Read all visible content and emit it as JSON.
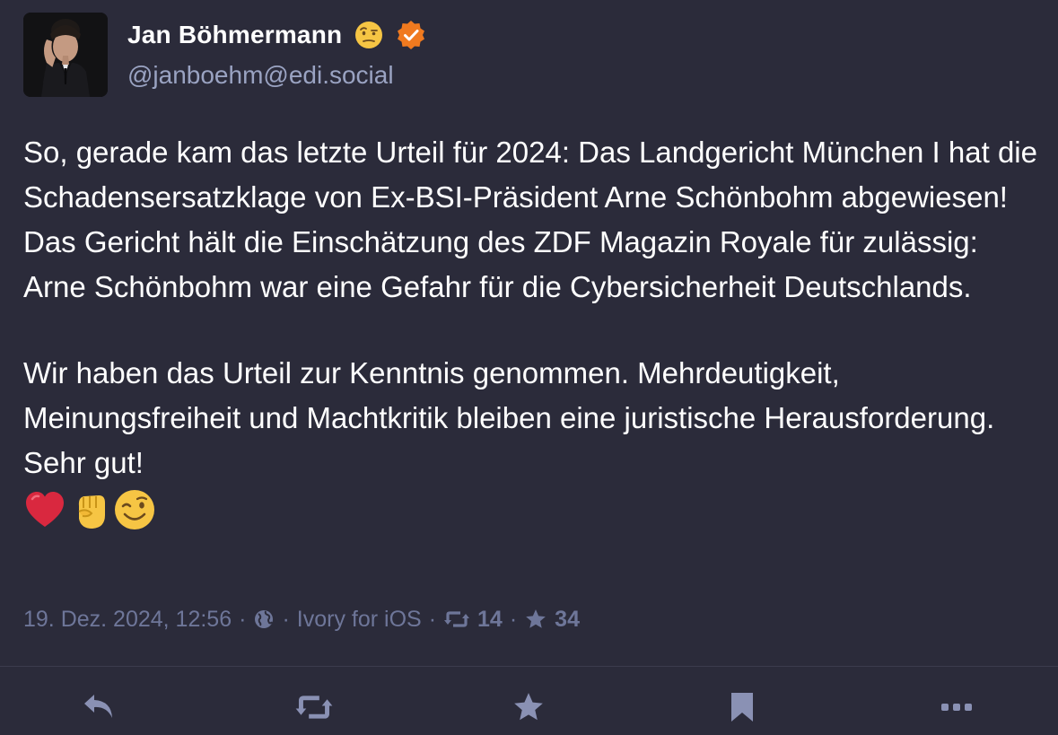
{
  "author": {
    "display_name": "Jan Böhmermann",
    "handle": "@janboehm@edi.social",
    "name_emoji": "face-with-raised-eyebrow",
    "verified_color": "#f07a1f"
  },
  "post": {
    "paragraph_1": "So, gerade kam das letzte Urteil für 2024: Das Landgericht München I hat die Schadensersatzklage von Ex-BSI-Präsident Arne Schönbohm abgewiesen! Das Gericht hält die Einschätzung des ZDF Magazin Royale für zulässig: Arne Schönbohm war eine Gefahr für die Cybersicherheit Deutschlands.",
    "paragraph_2": "Wir haben das Urteil zur Kenntnis genommen. Mehrdeutigkeit, Meinungsfreiheit und Machtkritik bleiben eine juristische Herausforderung. Sehr gut!",
    "emojis": [
      "red-heart",
      "raised-fist",
      "winking-face"
    ]
  },
  "meta": {
    "date": "19. Dez. 2024, 12:56",
    "separator": "·",
    "visibility_icon": "globe-icon",
    "client": "Ivory for iOS",
    "boosts": "14",
    "favorites": "34"
  },
  "actions": [
    "reply",
    "boost",
    "favorite",
    "bookmark",
    "more"
  ],
  "colors": {
    "background": "#2b2b3a",
    "text": "#ffffff",
    "handle": "#9aa3c2",
    "meta": "#6e7699",
    "action_icons": "#8a91b4"
  }
}
